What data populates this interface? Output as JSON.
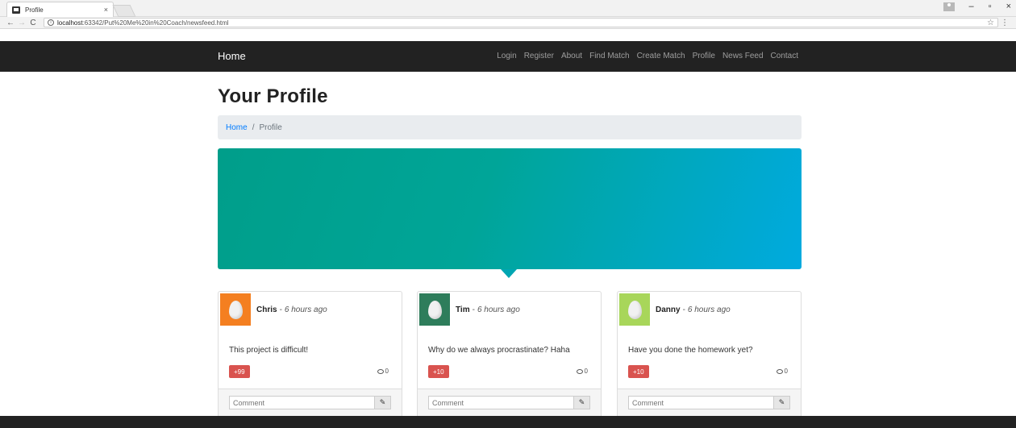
{
  "browser": {
    "tab_title": "Profile",
    "tab_close": "×",
    "url_host": "localhost",
    "url_rest": ":63342/Put%20Me%20in%20Coach/newsfeed.html",
    "back": "←",
    "forward": "→",
    "reload": "C",
    "info": "i",
    "star": "☆",
    "menu": "⋮",
    "minimize": "–",
    "restore": "▫",
    "close": "×"
  },
  "navbar": {
    "brand": "Home",
    "links": [
      "Login",
      "Register",
      "About",
      "Find Match",
      "Create Match",
      "Profile",
      "News Feed",
      "Contact"
    ]
  },
  "page": {
    "title": "Your Profile",
    "breadcrumb_home": "Home",
    "breadcrumb_sep": "/",
    "breadcrumb_current": "Profile"
  },
  "colors": {
    "navbar_bg": "#222222",
    "hero_start": "#009e8a",
    "hero_end": "#00aadf",
    "vote_badge": "#d9534f"
  },
  "posts": [
    {
      "author": "Chris",
      "dash": "-",
      "time": "6 hours ago",
      "text": "This project is difficult!",
      "votes": "+99",
      "comments": "0",
      "avatar_color": "#f47f20",
      "comment_placeholder": "Comment"
    },
    {
      "author": "Tim",
      "dash": "-",
      "time": "6 hours ago",
      "text": "Why do we always procrastinate? Haha",
      "votes": "+10",
      "comments": "0",
      "avatar_color": "#2e7d5b",
      "comment_placeholder": "Comment"
    },
    {
      "author": "Danny",
      "dash": "-",
      "time": "6 hours ago",
      "text": "Have you done the homework yet?",
      "votes": "+10",
      "comments": "0",
      "avatar_color": "#a8d65a",
      "comment_placeholder": "Comment"
    }
  ],
  "icons": {
    "comment_count": "comment-icon",
    "comment_submit": "edit-icon",
    "avatar": "egg-avatar-icon"
  }
}
